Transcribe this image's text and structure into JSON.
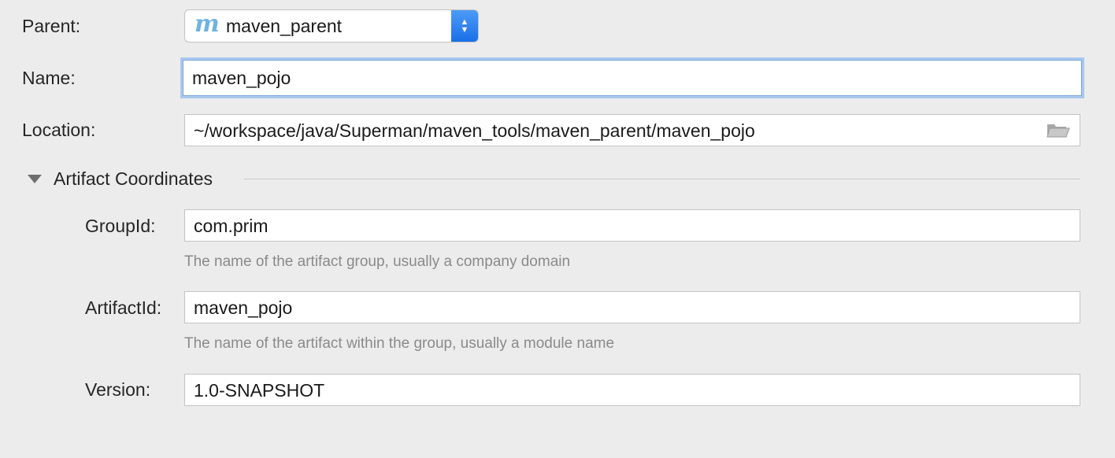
{
  "form": {
    "parent": {
      "label": "Parent:",
      "value": "maven_parent",
      "icon": "maven-module-icon"
    },
    "name": {
      "label": "Name:",
      "value": "maven_pojo"
    },
    "location": {
      "label": "Location:",
      "value": "~/workspace/java/Superman/maven_tools/maven_parent/maven_pojo",
      "icon": "folder-icon"
    }
  },
  "artifact": {
    "section_title": "Artifact Coordinates",
    "group_id": {
      "label": "GroupId:",
      "value": "com.prim",
      "hint": "The name of the artifact group, usually a company domain"
    },
    "artifact_id": {
      "label": "ArtifactId:",
      "value": "maven_pojo",
      "hint": "The name of the artifact within the group, usually a module name"
    },
    "version": {
      "label": "Version:",
      "value": "1.0-SNAPSHOT"
    }
  },
  "colors": {
    "focus_ring": "#a9c8ee",
    "combo_arrow": "#1a6fe8",
    "maven_icon": "#6cb4e4"
  }
}
